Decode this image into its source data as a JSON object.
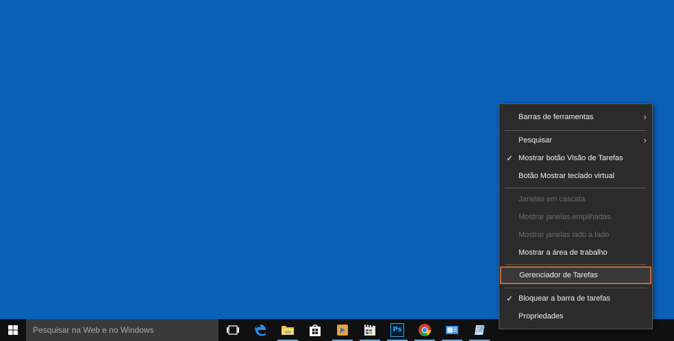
{
  "taskbar": {
    "search_placeholder": "Pesquisar na Web e no Windows",
    "icons": [
      "windows-icon",
      "task-view-icon",
      "edge-icon",
      "file-explorer-icon",
      "store-icon",
      "media-player-icon",
      "movie-maker-icon",
      "photoshop-icon",
      "chrome-icon",
      "mail-icon",
      "notepad-icon"
    ],
    "photoshop_label": "Ps"
  },
  "context_menu": {
    "toolbars": "Barras de ferramentas",
    "search": "Pesquisar",
    "show_task_view": "Mostrar botão Visão de Tarefas",
    "show_keyboard": "Botão Mostrar teclado virtual",
    "cascade": "Janelas em cascata",
    "stacked": "Mostrar janelas empilhadas",
    "side_by_side": "Mostrar janelas lado a lado",
    "show_desktop": "Mostrar a área de trabalho",
    "task_manager": "Gerenciador de Tarefas",
    "lock_taskbar": "Bloquear a barra de tarefas",
    "properties": "Propriedades",
    "check_glyph": "✓",
    "submenu_glyph": "›"
  },
  "colors": {
    "desktop": "#0b60b8",
    "menu_bg": "#2b2b2b",
    "highlight_border": "#c4663a",
    "taskbar": "#101010"
  }
}
